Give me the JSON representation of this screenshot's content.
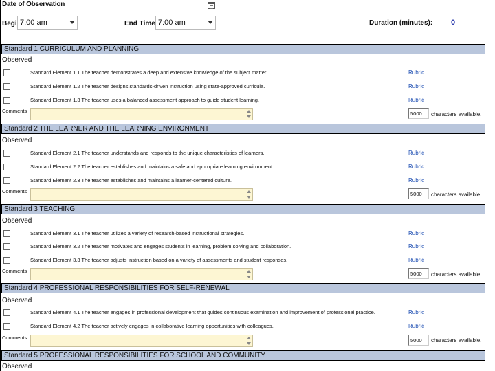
{
  "header": {
    "date_label": "Date of Observation",
    "begin_label": "Begin time:",
    "begin_value": "7:00 am",
    "end_label": "End Time:",
    "end_value": "7:00 am",
    "duration_label": "Duration (minutes):",
    "duration_value": "0"
  },
  "observed_label": "Observed",
  "comments_label": "Comments",
  "rubric_label": "Rubric",
  "chars_label": "characters available.",
  "chars_value": "5000",
  "standards": [
    {
      "title": "Standard 1 CURRICULUM AND PLANNING",
      "elements": [
        "Standard Element 1.1 The teacher demonstrates a deep and extensive knowledge of the subject matter.",
        "Standard Element 1.2 The teacher designs standards-driven instruction using state-approved curricula.",
        "Standard Element 1.3 The teacher uses a balanced assessment approach to guide student learning."
      ]
    },
    {
      "title": "Standard 2 THE LEARNER AND THE LEARNING ENVIRONMENT",
      "elements": [
        "Standard Element 2.1 The teacher understands and responds to the unique characteristics of learners.",
        "Standard Element 2.2 The teacher establishes and maintains a safe and appropriate learning environment.",
        "Standard Element 2.3 The teacher establishes and maintains a learner-centered culture."
      ]
    },
    {
      "title": "Standard 3 TEACHING",
      "elements": [
        "Standard Element 3.1 The teacher utilizes a variety of research-based instructional strategies.",
        "Standard Element 3.2 The teacher motivates and engages students in learning, problem solving and collaboration.",
        "Standard Element 3.3 The teacher adjusts instruction based on a variety of assessments and student responses."
      ]
    },
    {
      "title": "Standard 4 PROFESSIONAL RESPONSIBILITIES FOR SELF-RENEWAL",
      "elements": [
        "Standard Element 4.1 The teacher engages in professional development that guides continuous examination and improvement of professional practice.",
        "Standard Element 4.2 The teacher actively engages in collaborative learning opportunities with colleagues."
      ]
    },
    {
      "title": "Standard 5 PROFESSIONAL RESPONSIBILITIES FOR SCHOOL AND COMMUNITY",
      "elements": []
    }
  ]
}
